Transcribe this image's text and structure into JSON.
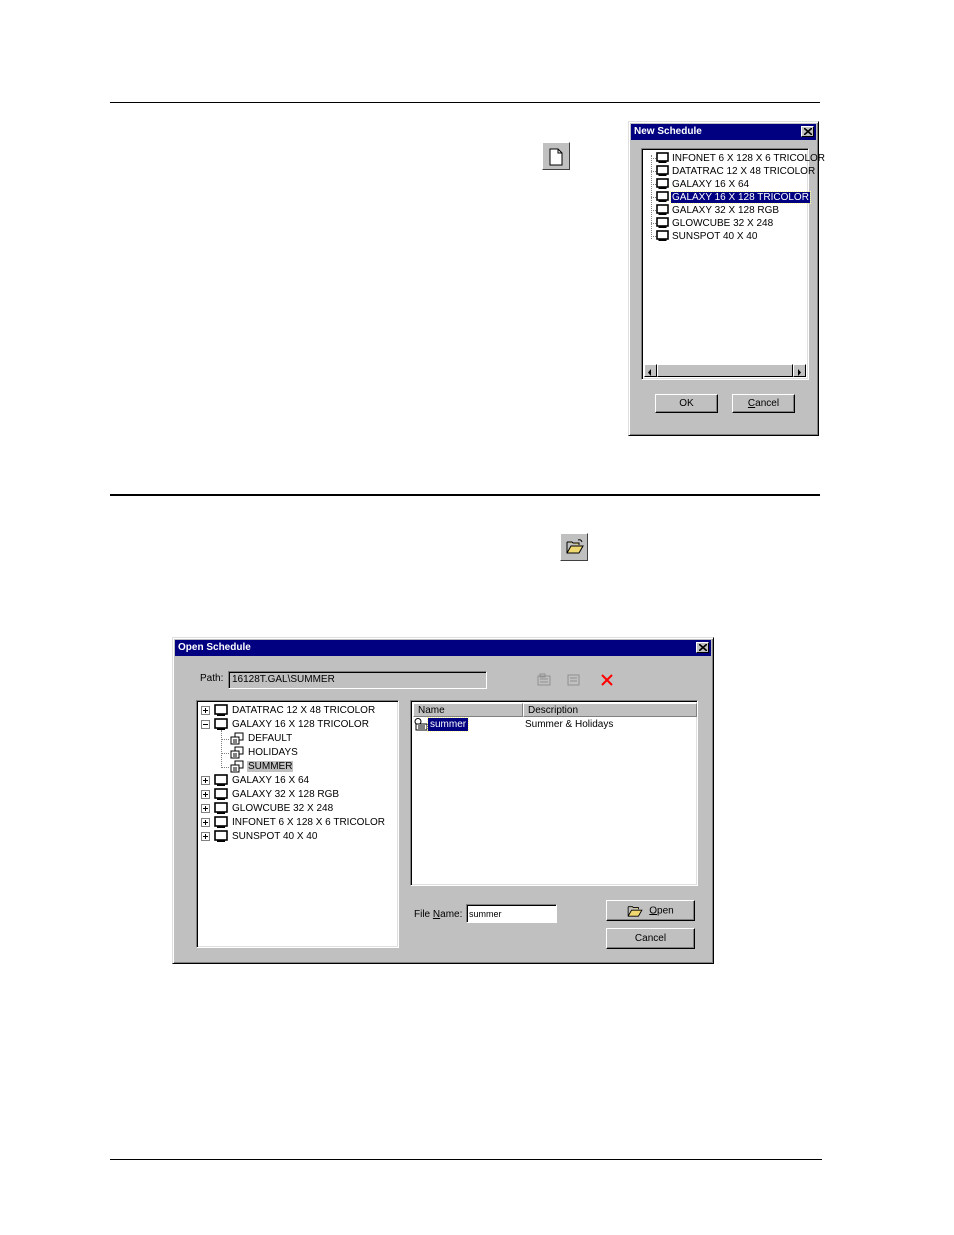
{
  "new_schedule": {
    "title": "New Schedule",
    "items": [
      {
        "label": "INFONET 6 X 128 X 6 TRICOLOR"
      },
      {
        "label": "DATATRAC 12 X 48 TRICOLOR"
      },
      {
        "label": "GALAXY 16 X 64"
      },
      {
        "label": "GALAXY 16 X 128 TRICOLOR"
      },
      {
        "label": "GALAXY 32 X 128 RGB"
      },
      {
        "label": "GLOWCUBE 32 X 248"
      },
      {
        "label": "SUNSPOT 40 X 40"
      }
    ],
    "selected_index": 3,
    "ok_label": "OK",
    "cancel_label": "Cancel",
    "cancel_accel": "C",
    "cancel_rest": "ancel"
  },
  "open_schedule": {
    "title": "Open Schedule",
    "path_label": "Path:",
    "path_value": "16128T.GAL\\SUMMER",
    "tree": [
      {
        "label": "DATATRAC 12 X 48 TRICOLOR",
        "type": "device",
        "expanded": false
      },
      {
        "label": "GALAXY 16 X 128 TRICOLOR",
        "type": "device",
        "expanded": true
      },
      {
        "label": "DEFAULT",
        "type": "schedule"
      },
      {
        "label": "HOLIDAYS",
        "type": "schedule"
      },
      {
        "label": "SUMMER",
        "type": "schedule",
        "selected": true
      },
      {
        "label": "GALAXY 16 X 64",
        "type": "device",
        "expanded": false
      },
      {
        "label": "GALAXY 32 X 128 RGB",
        "type": "device",
        "expanded": false
      },
      {
        "label": "GLOWCUBE 32 X 248",
        "type": "device",
        "expanded": false
      },
      {
        "label": "INFONET 6 X 128 X 6 TRICOLOR",
        "type": "device",
        "expanded": false
      },
      {
        "label": "SUNSPOT 40 X 40",
        "type": "device",
        "expanded": false
      }
    ],
    "list_headers": [
      "Name",
      "Description"
    ],
    "list_rows": [
      {
        "name": "summer",
        "description": "Summer & Holidays"
      }
    ],
    "file_name_label_pre": "File ",
    "file_name_accel": "N",
    "file_name_label_post": "ame:",
    "file_name_value": "summer",
    "open_label_accel": "O",
    "open_label_rest": "pen",
    "cancel_label": "Cancel"
  },
  "icons": {
    "new": "new-document-icon",
    "open": "open-folder-icon",
    "delete": "delete-x-icon"
  },
  "colors": {
    "title_bar": "#000080",
    "window_face": "#c0c0c0",
    "delete_red": "#ff0000"
  }
}
